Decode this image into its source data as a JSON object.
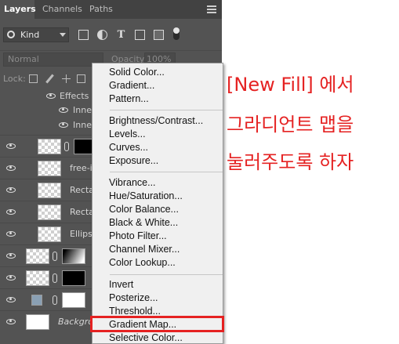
{
  "panel": {
    "tabs": [
      "Layers",
      "Channels",
      "Paths"
    ],
    "filter_kind": "Kind",
    "blend_mode": "Normal",
    "opacity_label": "Opacity:",
    "opacity_value": "100%",
    "lock_label": "Lock:",
    "effects": {
      "label": "Effects",
      "items": [
        "Inner",
        "Inner"
      ]
    },
    "layers": [
      {
        "name": ""
      },
      {
        "name": "free-ic"
      },
      {
        "name": "Rectan"
      },
      {
        "name": "Rectan"
      },
      {
        "name": "Ellipse"
      },
      {
        "name": ""
      },
      {
        "name": ""
      },
      {
        "name": ""
      },
      {
        "name": "Backgrou"
      }
    ]
  },
  "fill_menu": {
    "groups": [
      [
        "Solid Color...",
        "Gradient...",
        "Pattern..."
      ],
      [
        "Brightness/Contrast...",
        "Levels...",
        "Curves...",
        "Exposure..."
      ],
      [
        "Vibrance...",
        "Hue/Saturation...",
        "Color Balance...",
        "Black & White...",
        "Photo Filter...",
        "Channel Mixer...",
        "Color Lookup..."
      ],
      [
        "Invert",
        "Posterize...",
        "Threshold...",
        "Gradient Map...",
        "Selective Color..."
      ]
    ],
    "highlighted_item": "Gradient Map..."
  },
  "annotation": {
    "lines": [
      "[New Fill] 에서",
      "그라디언트 맵을",
      "눌러주도록 하자"
    ],
    "color": "#e52222"
  }
}
